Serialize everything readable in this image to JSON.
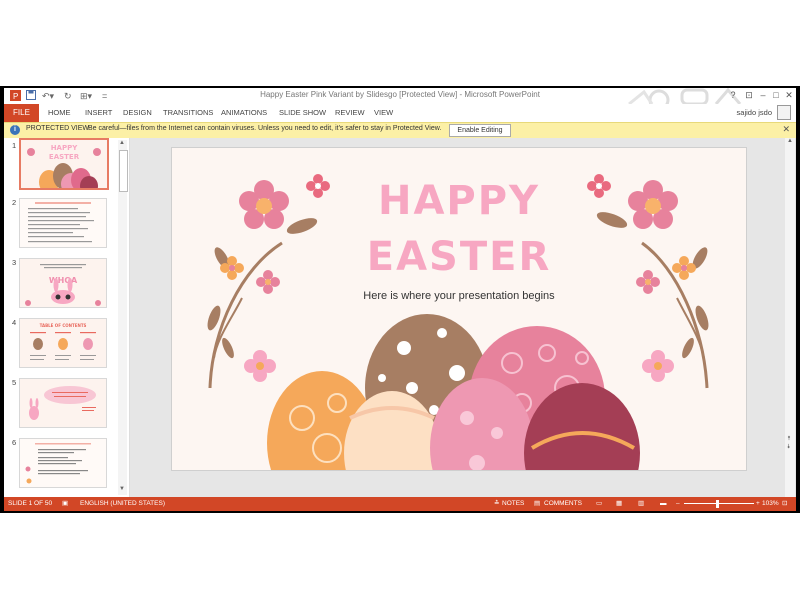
{
  "window": {
    "title": "Happy Easter Pink Variant by Slidesgo [Protected View] - Microsoft PowerPoint",
    "user": "sajido jsdo"
  },
  "ribbon": {
    "file": "FILE",
    "tabs": [
      "HOME",
      "INSERT",
      "DESIGN",
      "TRANSITIONS",
      "ANIMATIONS",
      "SLIDE SHOW",
      "REVIEW",
      "VIEW"
    ]
  },
  "protected_view": {
    "title": "PROTECTED VIEW",
    "message": "Be careful—files from the Internet can contain viruses. Unless you need to edit, it's safer to stay in Protected View.",
    "button": "Enable Editing"
  },
  "thumbnails": {
    "numbers": [
      "1",
      "2",
      "3",
      "4",
      "5",
      "6"
    ],
    "slide1_title_a": "HAPPY",
    "slide1_title_b": "EASTER",
    "slide3_word": "WHOA",
    "slide4_title": "TABLE OF CONTENTS"
  },
  "slide": {
    "title_line1": "HAPPY",
    "title_line2": "EASTER",
    "subtitle": "Here is where your presentation begins"
  },
  "statusbar": {
    "slide_count": "SLIDE 1 OF 50",
    "language": "ENGLISH (UNITED STATES)",
    "notes": "NOTES",
    "comments": "COMMENTS",
    "zoom": "103%"
  },
  "colors": {
    "accent": "#d24726",
    "title_pink": "#f7a7c2",
    "warning_bar": "#fcf0a6"
  }
}
